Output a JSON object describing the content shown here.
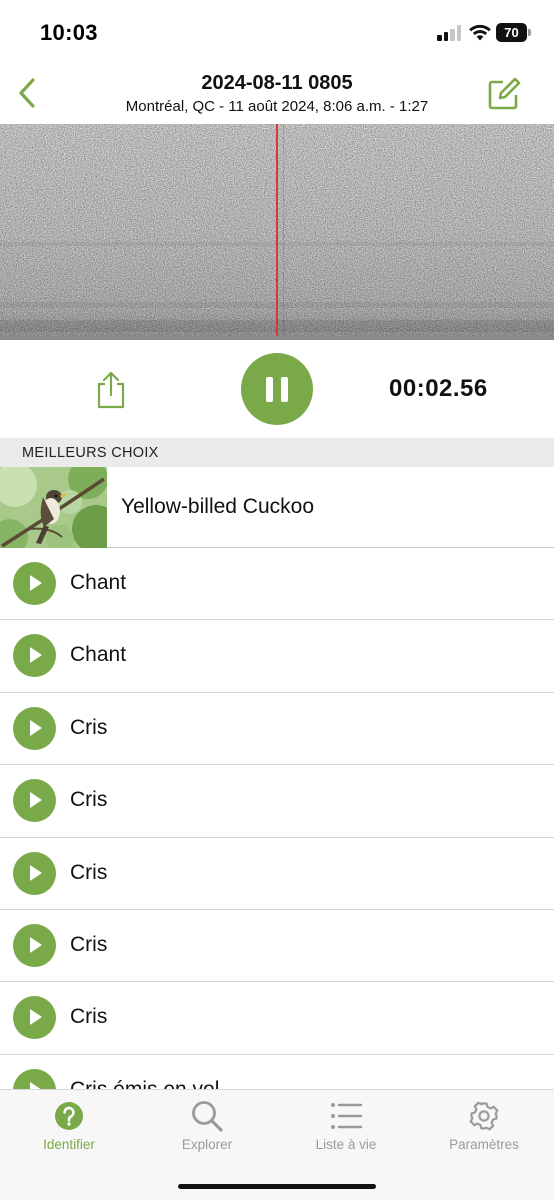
{
  "status_bar": {
    "time": "10:03",
    "battery": "70"
  },
  "header": {
    "title": "2024-08-11 0805",
    "subtitle": "Montréal, QC - 11 août 2024, 8:06 a.m. - 1:27",
    "back_icon": "chevron-left-icon",
    "edit_icon": "edit-note-icon"
  },
  "player": {
    "elapsed": "00:02.56",
    "state": "playing",
    "share_icon": "share-icon",
    "pause_icon": "pause-icon"
  },
  "results": {
    "section_title": "MEILLEURS CHOIX",
    "top_match": {
      "name": "Yellow-billed Cuckoo"
    },
    "sounds": [
      {
        "label": "Chant"
      },
      {
        "label": "Chant"
      },
      {
        "label": "Cris"
      },
      {
        "label": "Cris"
      },
      {
        "label": "Cris"
      },
      {
        "label": "Cris"
      },
      {
        "label": "Cris"
      },
      {
        "label": "Cris émis en vol"
      }
    ]
  },
  "tabs": [
    {
      "label": "Identifier",
      "icon": "question-circle-icon",
      "active": true
    },
    {
      "label": "Explorer",
      "icon": "search-icon",
      "active": false
    },
    {
      "label": "Liste à vie",
      "icon": "list-icon",
      "active": false
    },
    {
      "label": "Paramètres",
      "icon": "gear-icon",
      "active": false
    }
  ],
  "colors": {
    "accent": "#7aa94a",
    "playhead": "#d33b3b",
    "inactive_tab": "#9a9a9a"
  }
}
